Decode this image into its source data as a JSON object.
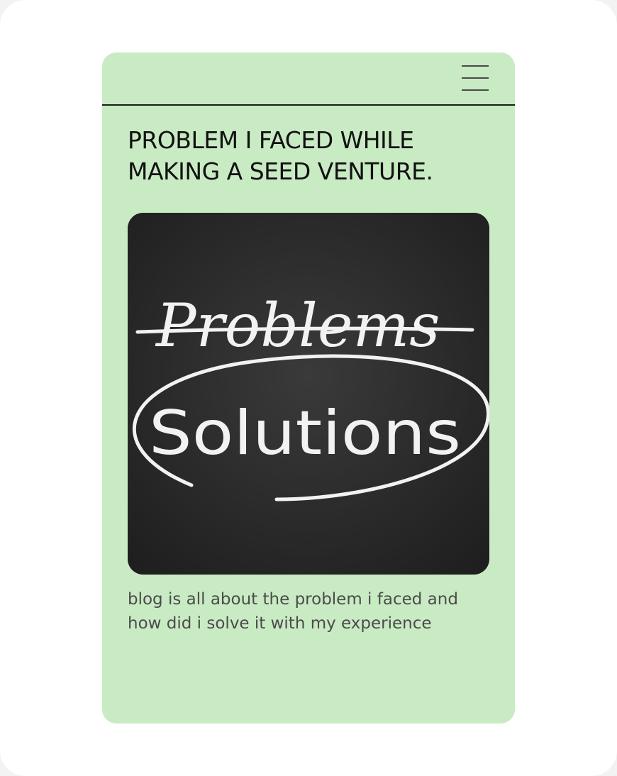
{
  "header": {
    "menu_icon": "hamburger-menu-icon"
  },
  "post": {
    "title": "PROBLEM I FACED WHILE MAKING A SEED VENTURE.",
    "image": {
      "strikethrough_word": "Problems",
      "circled_word": "Solutions"
    },
    "description": "blog is all about the problem i faced and how did i solve it with my experience"
  },
  "colors": {
    "card_background": "#c9ebc3",
    "chalkboard": "#2b2b2b",
    "chalk": "#f2f2f2"
  }
}
